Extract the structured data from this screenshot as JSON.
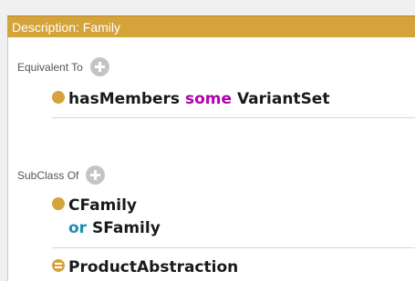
{
  "header": {
    "title": "Description: Family"
  },
  "equivalent": {
    "label": "Equivalent To",
    "item": {
      "property": "hasMembers",
      "keyword": "some",
      "filler": "VariantSet"
    }
  },
  "subclass": {
    "label": "SubClass Of",
    "items": [
      {
        "first": "CFamily",
        "keyword": "or",
        "second": "SFamily"
      },
      {
        "name": "ProductAbstraction"
      }
    ]
  },
  "colors": {
    "header": "#d4a33a",
    "some_keyword": "#b000b0",
    "or_keyword": "#1a8fb0"
  }
}
